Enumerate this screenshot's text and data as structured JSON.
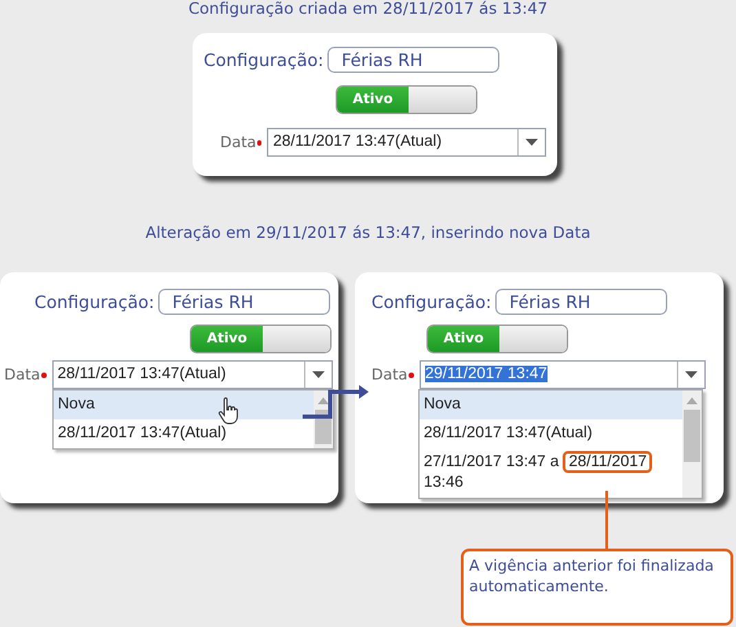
{
  "top": {
    "title": "Configuração criada em 28/11/2017 ás 13:47",
    "panel": {
      "config_label": "Configuração:",
      "config_value": "Férias RH",
      "toggle": {
        "label": "Ativo",
        "on": true
      },
      "date_label": "Data",
      "date_value": "28/11/2017 13:47(Atual)",
      "text_selected": false
    }
  },
  "bottom": {
    "title": "Alteração em 29/11/2017 ás 13:47, inserindo nova Data",
    "panels": [
      {
        "config_label": "Configuração:",
        "config_value": "Férias RH",
        "toggle": {
          "label": "Ativo",
          "on": true
        },
        "date_label": "Data",
        "date_value": "28/11/2017 13:47(Atual)",
        "text_selected": false,
        "options": [
          {
            "text": "Nova",
            "selected": true
          },
          {
            "text": "28/11/2017 13:47(Atual)",
            "selected": false
          }
        ]
      },
      {
        "config_label": "Configuração:",
        "config_value": "Férias RH",
        "toggle": {
          "label": "Ativo",
          "on": true
        },
        "date_label": "Data",
        "date_value": "29/11/2017 13:47",
        "text_selected": true,
        "options": [
          {
            "text": "Nova",
            "selected": true
          },
          {
            "text": "28/11/2017 13:47(Atual)",
            "selected": false
          },
          {
            "text": "27/11/2017 13:47 a",
            "marked_text": "28/11/2017",
            "tail": "13:46",
            "selected": false
          }
        ]
      }
    ],
    "callout": "A vigência anterior foi finalizada automaticamente."
  }
}
